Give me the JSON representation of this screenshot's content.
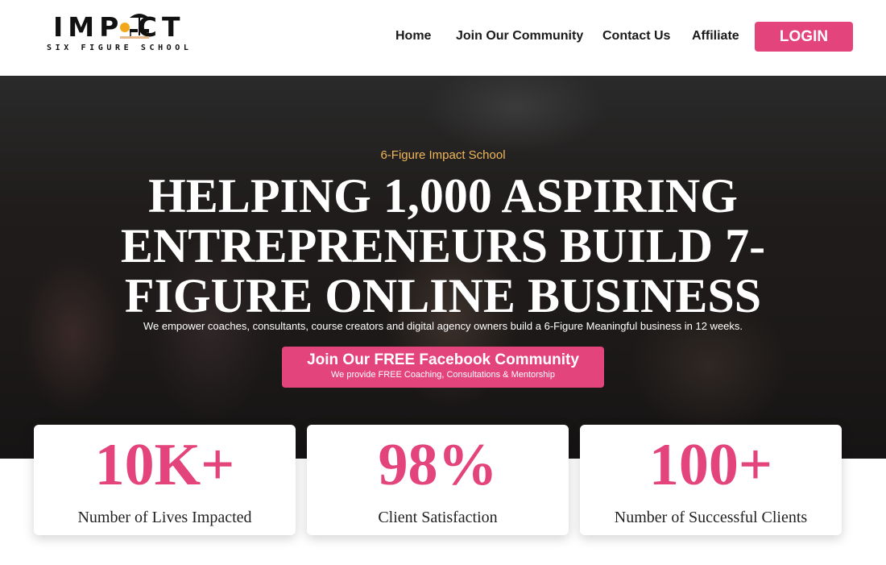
{
  "brand": {
    "logo_word": "IMP  CT",
    "logo_sub": "SIX FIGURE SCHOOL"
  },
  "nav": {
    "items": [
      {
        "label": "Home"
      },
      {
        "label": "Join Our Community"
      },
      {
        "label": "Contact Us"
      },
      {
        "label": "Affiliate"
      }
    ],
    "login_label": "LOGIN"
  },
  "hero": {
    "eyebrow": "6-Figure Impact School",
    "headline": "HELPING 1,000 ASPIRING ENTREPRENEURS BUILD 7-FIGURE ONLINE BUSINESS",
    "subtext": "We empower coaches, consultants, course creators and digital agency owners build a 6-Figure Meaningful business in 12 weeks.",
    "cta_title": "Join Our FREE Facebook Community",
    "cta_sub": "We provide FREE Coaching, Consultations & Mentorship"
  },
  "stats": [
    {
      "value": "10K+",
      "label": "Number of Lives Impacted"
    },
    {
      "value": "98%",
      "label": "Client Satisfaction"
    },
    {
      "value": "100+",
      "label": "Number of Successful Clients"
    }
  ],
  "colors": {
    "accent": "#e3447b",
    "eyebrow": "#f0b75a",
    "hero_bg": "#1f1c1b"
  }
}
